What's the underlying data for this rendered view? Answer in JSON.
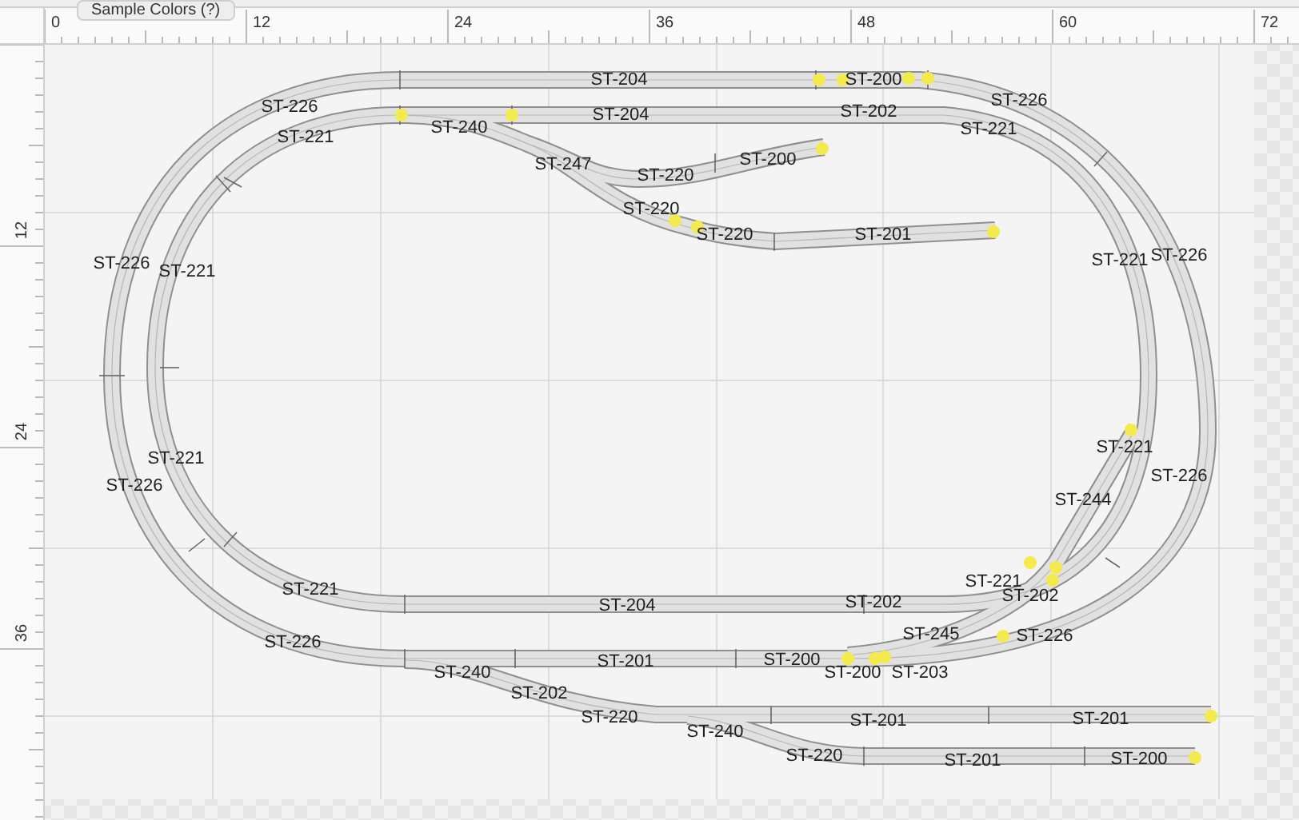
{
  "tab": {
    "label": "Sample Colors (?)"
  },
  "ruler_top": {
    "labels": [
      "0",
      "12",
      "24",
      "36",
      "48",
      "60",
      "72"
    ]
  },
  "ruler_left": {
    "labels": [
      "12",
      "24",
      "36"
    ]
  },
  "track_labels": [
    "ST-204",
    "ST-200",
    "ST-226",
    "ST-204",
    "ST-202",
    "ST-226",
    "ST-221",
    "ST-240",
    "ST-221",
    "ST-247",
    "ST-220",
    "ST-200",
    "ST-220",
    "ST-220",
    "ST-201",
    "ST-226",
    "ST-221",
    "ST-221",
    "ST-226",
    "ST-221",
    "ST-221",
    "ST-226",
    "ST-226",
    "ST-244",
    "ST-221",
    "ST-204",
    "ST-202",
    "ST-221",
    "ST-202",
    "ST-245",
    "ST-226",
    "ST-226",
    "ST-201",
    "ST-200",
    "ST-240",
    "ST-200",
    "ST-203",
    "ST-202",
    "ST-220",
    "ST-201",
    "ST-201",
    "ST-240",
    "ST-220",
    "ST-201",
    "ST-200"
  ]
}
